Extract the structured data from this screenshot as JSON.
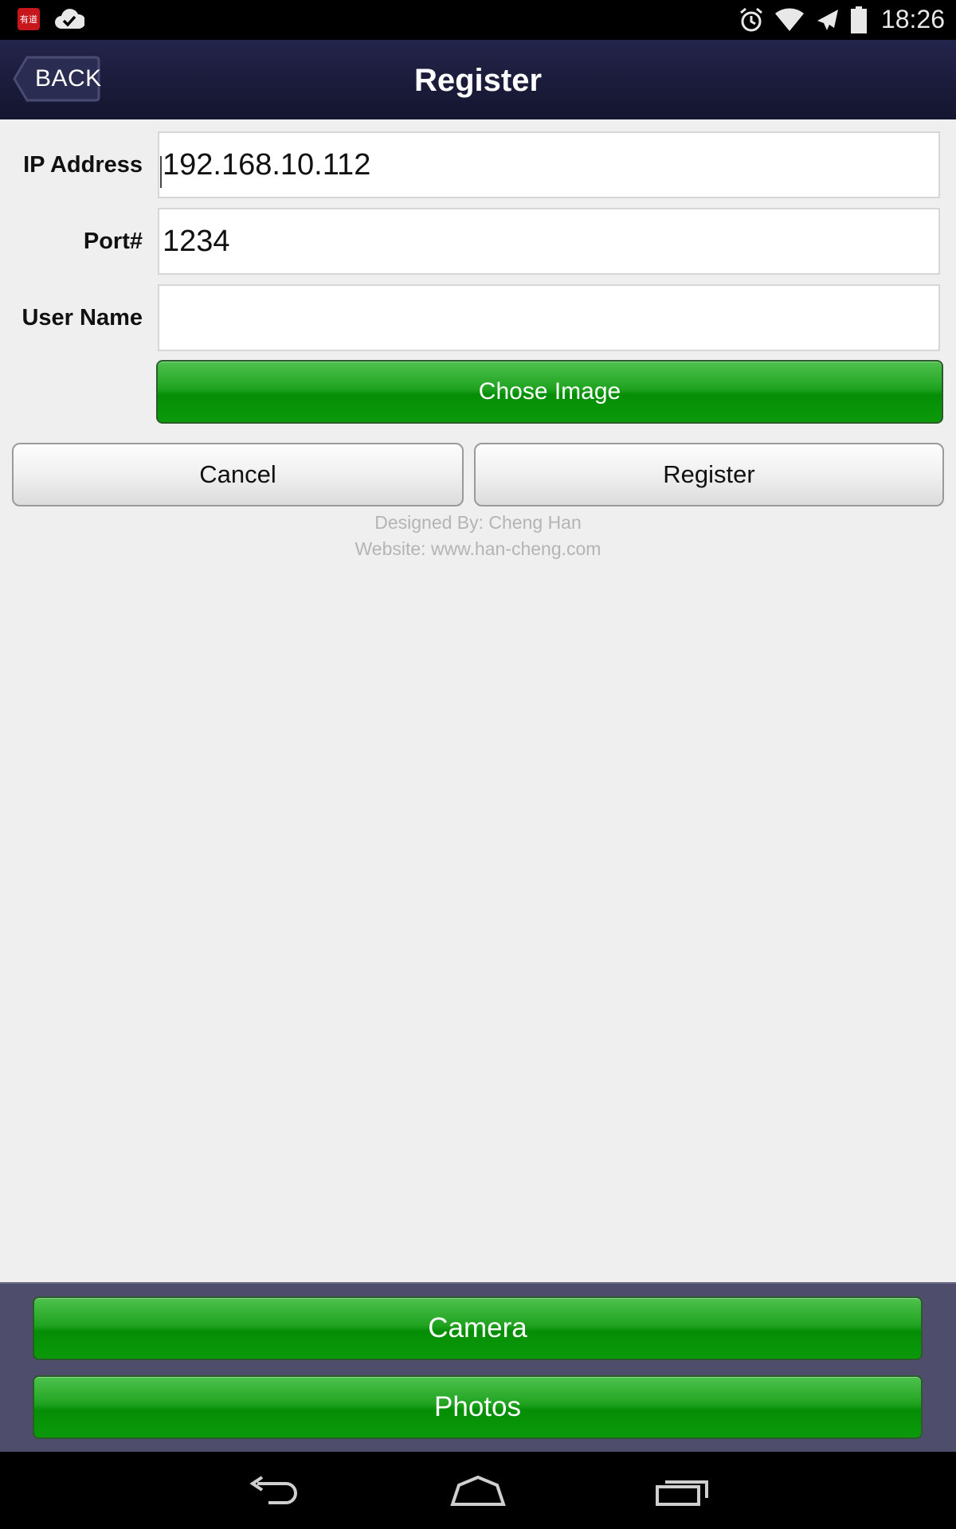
{
  "status_bar": {
    "app_icon_text": "有道",
    "time": "18:26"
  },
  "header": {
    "back_label": "BACK",
    "title": "Register"
  },
  "form": {
    "ip_label": "IP Address",
    "ip_value": "192.168.10.112",
    "port_label": "Port#",
    "port_value": "1234",
    "username_label": "User Name",
    "username_value": "",
    "chose_image_label": "Chose Image"
  },
  "actions": {
    "cancel_label": "Cancel",
    "register_label": "Register"
  },
  "credits": {
    "designed_by": "Designed By: Cheng Han",
    "website": "Website: www.han-cheng.com"
  },
  "image_source": {
    "camera_label": "Camera",
    "photos_label": "Photos"
  },
  "colors": {
    "title_bar": "#1a1b3a",
    "green_button": "#109a10",
    "bottom_panel": "#4e4e6c",
    "background": "#efefef"
  },
  "icons": [
    "alarm-icon",
    "wifi-icon",
    "airplane-mode-icon",
    "battery-icon",
    "nav-back-icon",
    "nav-home-icon",
    "nav-recents-icon"
  ]
}
